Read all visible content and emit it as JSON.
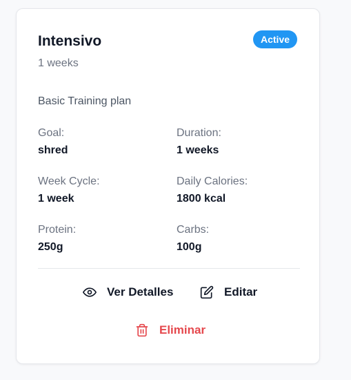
{
  "plan": {
    "title": "Intensivo",
    "subtitle": "1 weeks",
    "status": "Active",
    "description": "Basic Training plan"
  },
  "stats": [
    {
      "label": "Goal:",
      "value": "shred"
    },
    {
      "label": "Duration:",
      "value": "1 weeks"
    },
    {
      "label": "Week Cycle:",
      "value": "1 week"
    },
    {
      "label": "Daily Calories:",
      "value": "1800 kcal"
    },
    {
      "label": "Protein:",
      "value": "250g"
    },
    {
      "label": "Carbs:",
      "value": "100g"
    }
  ],
  "actions": {
    "details_label": "Ver Detalles",
    "edit_label": "Editar",
    "delete_label": "Eliminar"
  },
  "icons": {
    "details": "eye-icon",
    "edit": "edit-square-icon",
    "delete": "trash-icon"
  },
  "colors": {
    "badge": "#2196f3",
    "danger": "#e5484d",
    "muted_text": "#6b7280"
  }
}
